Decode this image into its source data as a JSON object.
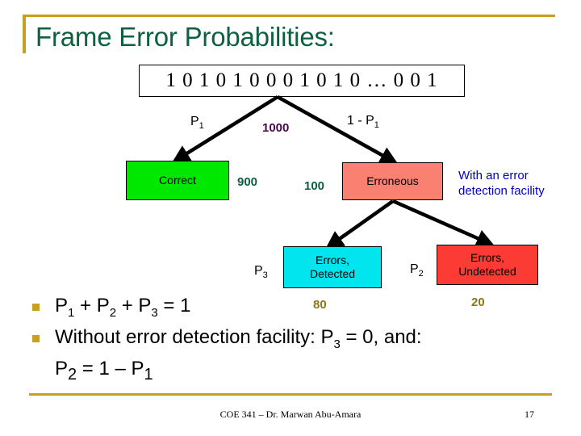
{
  "slide": {
    "title": "Frame Error Probabilities:",
    "accent_color": "#c8a021",
    "title_color": "#0d6040"
  },
  "frame": {
    "bits": "1 0 1 0 1 0 0 0 1 0 1 0 … 0 0 1"
  },
  "tree": {
    "level1": {
      "left_branch_label": "P",
      "left_branch_sub": "1",
      "right_branch_label": "1 - P",
      "right_branch_sub": "1",
      "source_count": "1000",
      "source_count_color": "#4b0a4b"
    },
    "nodes": {
      "correct": {
        "label": "Correct",
        "color": "#00e800",
        "count": "900",
        "count_color": "#0d6040"
      },
      "erroneous": {
        "label": "Erroneous",
        "color": "#fa8072",
        "count": "100",
        "count_color": "#0d6040"
      },
      "errors_detected": {
        "line1": "Errors,",
        "line2": "Detected",
        "color": "#00e5ee",
        "count": "80",
        "count_color": "#8a7518"
      },
      "errors_undetected": {
        "line1": "Errors,",
        "line2": "Undetected",
        "color": "#fc3b34",
        "count": "20",
        "count_color": "#8a7518"
      }
    },
    "level2": {
      "left_branch_label": "P",
      "left_branch_sub": "3",
      "right_branch_label": "P",
      "right_branch_sub": "2"
    }
  },
  "annotation": {
    "error_detection_facility": "With an error detection facility",
    "color": "#0000c8"
  },
  "bullets": [
    {
      "prefix": "P",
      "sub1": "1",
      "mid1": " + P",
      "sub2": "2",
      "mid2": " + P",
      "sub3": "3",
      "suffix": " = 1"
    },
    {
      "prefix": "Without error detection facility: P",
      "sub1": "3",
      "suffix": " = 0, and:",
      "continuation_prefix": "P",
      "continuation_sub": "2",
      "continuation_suffix": " = 1 – P",
      "continuation_sub2": "1"
    }
  ],
  "footer": {
    "course": "COE 341 – Dr. Marwan Abu-Amara",
    "page_number": "17"
  }
}
